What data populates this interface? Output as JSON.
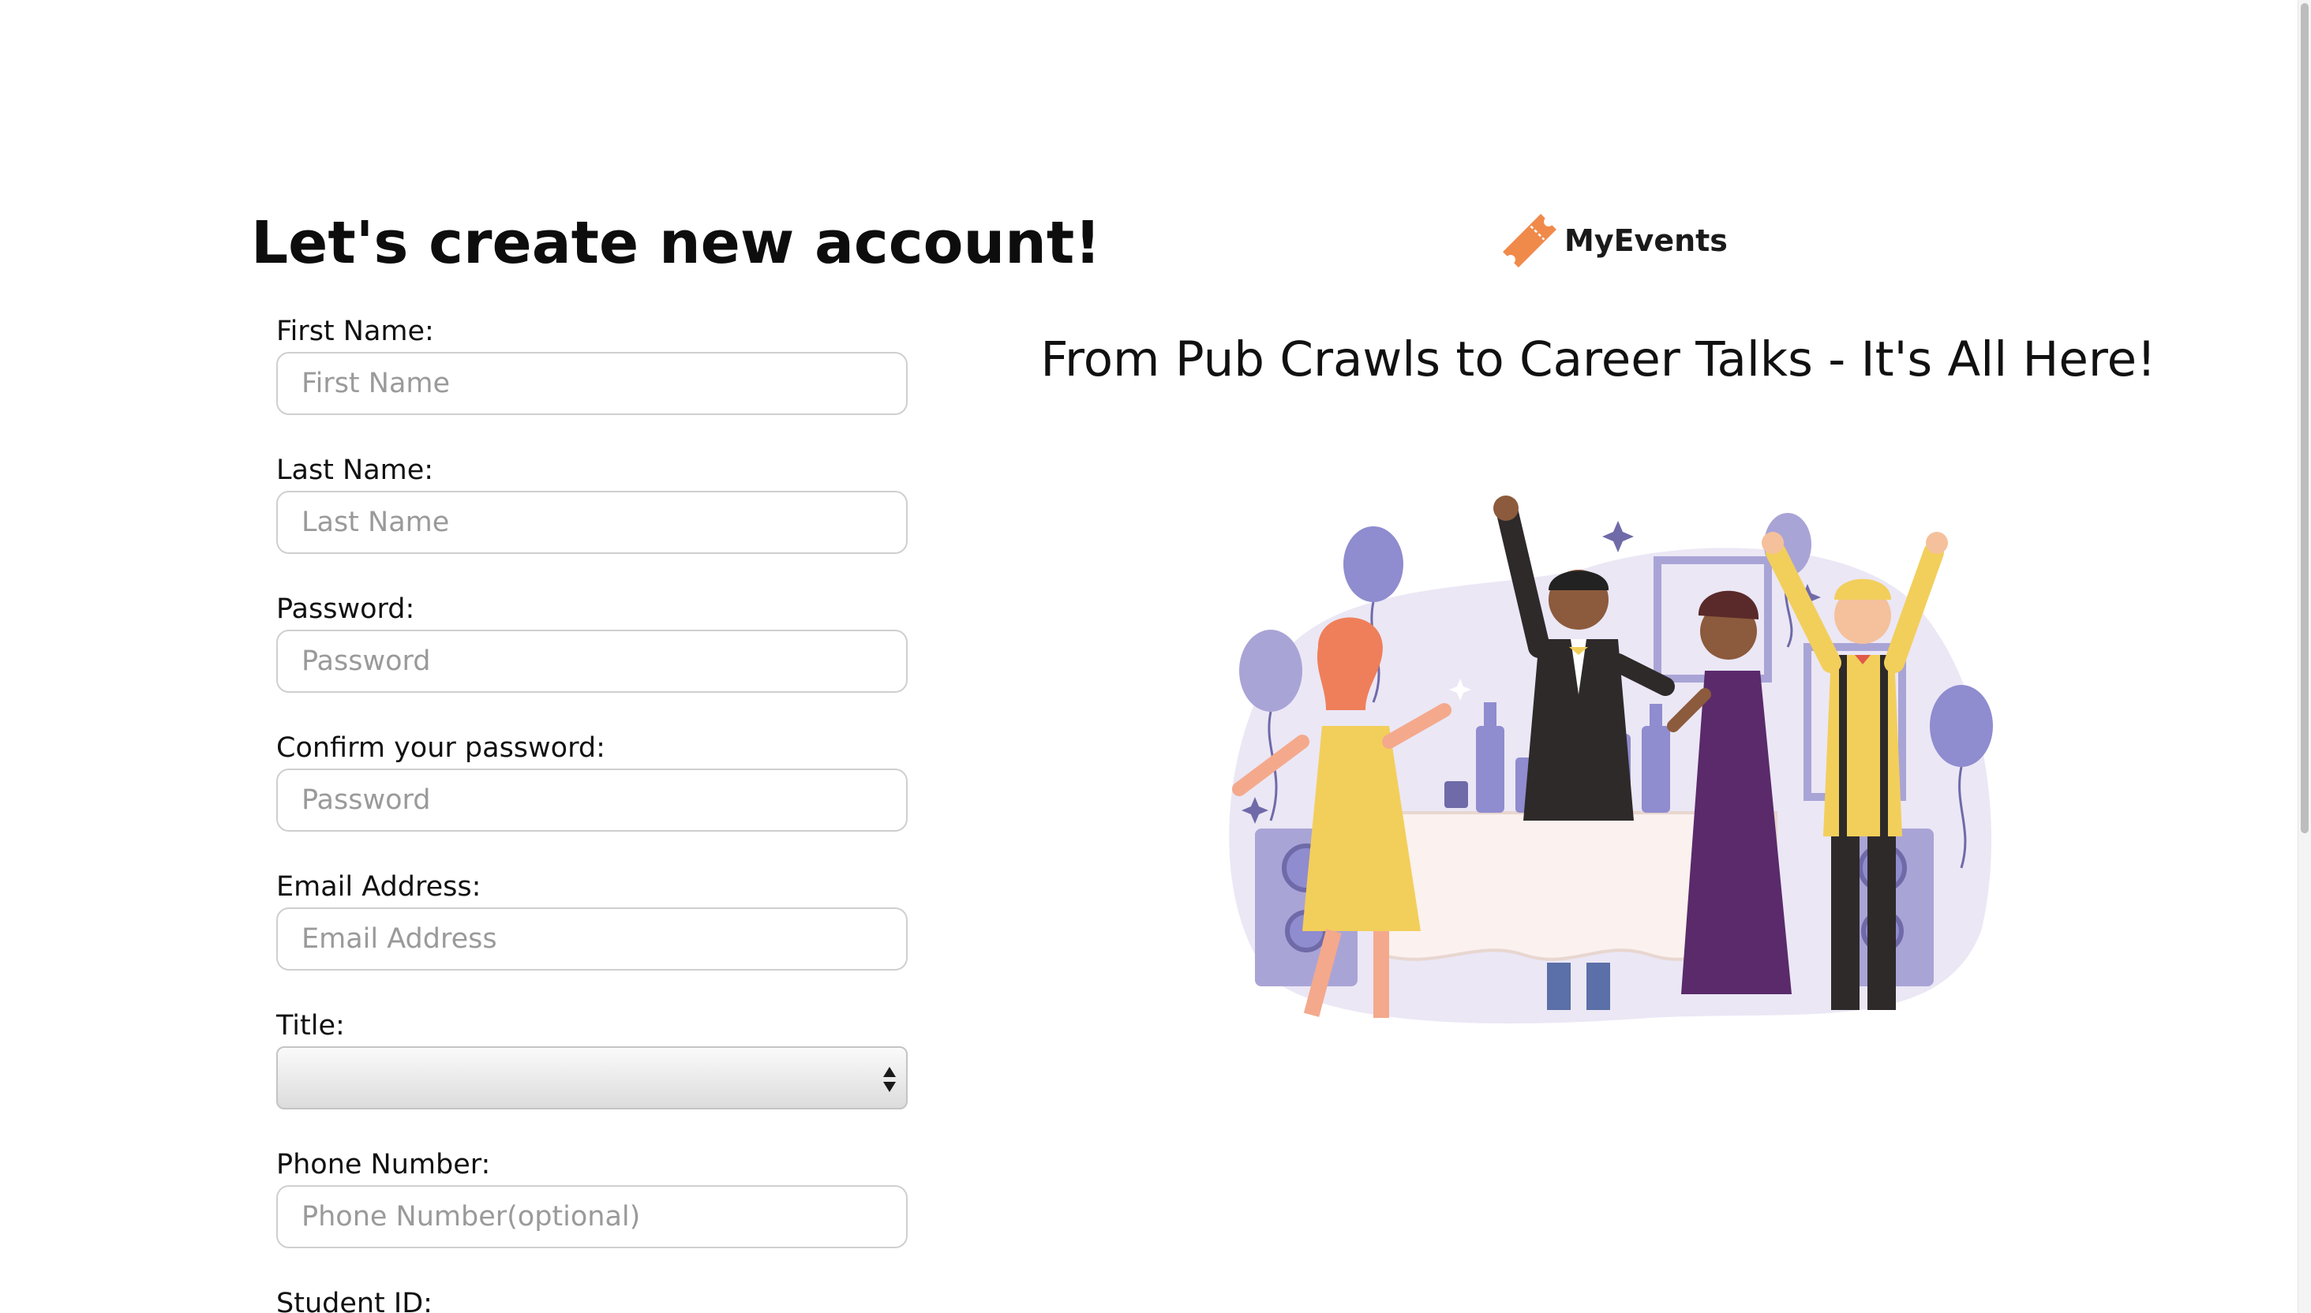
{
  "form": {
    "title": "Let's create new account!",
    "fields": [
      {
        "label": "First Name:",
        "placeholder": "First Name"
      },
      {
        "label": "Last Name:",
        "placeholder": "Last Name"
      },
      {
        "label": "Password:",
        "placeholder": "Password"
      },
      {
        "label": "Confirm your password:",
        "placeholder": "Password"
      },
      {
        "label": "Email Address:",
        "placeholder": "Email Address"
      },
      {
        "label": "Title:",
        "value": ""
      },
      {
        "label": "Phone Number:",
        "placeholder": "Phone Number(optional)"
      },
      {
        "label": "Student ID:"
      }
    ]
  },
  "brand": {
    "name": "MyEvents",
    "logo_icon": "ticket-icon",
    "logo_color": "#f08a4b"
  },
  "tagline": "From Pub Crawls to Career Talks - It's All Here!",
  "illustration": {
    "icon": "party-illustration",
    "accent_color": "#8f8ccf",
    "background_color": "#ebe7f5"
  }
}
